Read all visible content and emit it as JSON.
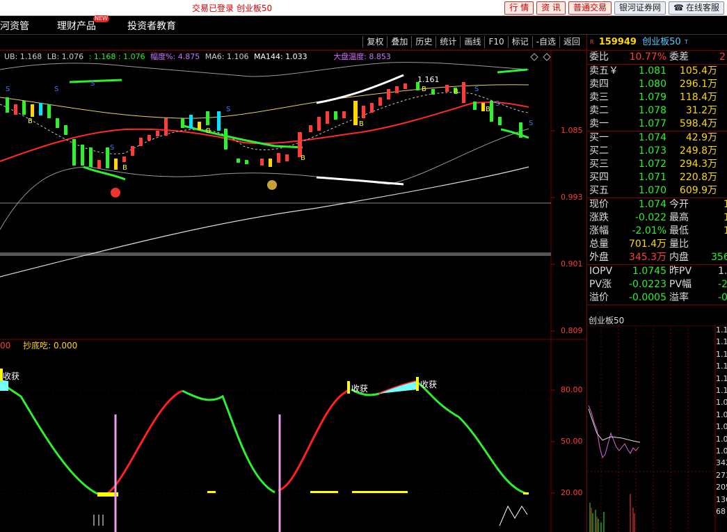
{
  "topbar": {
    "status": "交易已登录  创业板50",
    "buttons": [
      "行 情",
      "资 讯",
      "普通交易"
    ],
    "broker": "银河证券网",
    "service": "在线客服"
  },
  "menu": {
    "items": [
      "河资管",
      "理财产品",
      "投资者教育"
    ],
    "new_badge": "NEW"
  },
  "toolbar": {
    "items": [
      "复权",
      "叠加",
      "历史",
      "统计",
      "画线",
      "F10",
      "标记",
      "-自选",
      "返回"
    ]
  },
  "info": {
    "ub": "UB: 1.168",
    "lb": "LB: 1.076",
    "v1": ": 1.168",
    "v2": ": 1.076",
    "fudu_label": "幅度%:",
    "fudu": "4.875",
    "ma6": "MA6: 1.106",
    "ma144": "MA144: 1.033",
    "dapan_label": "大盘温度:",
    "dapan": "8.853",
    "high_mark": "1.161"
  },
  "main_axis": [
    "1.085",
    "0.993",
    "0.901",
    "0.809"
  ],
  "indicator": {
    "prefix": "00",
    "label": "抄底吃: 0.000",
    "axis": [
      "80.00",
      "50.00",
      "20.00"
    ],
    "tags": [
      "收获",
      "收获",
      "收获"
    ]
  },
  "colors": {
    "up": "#ff3c3c",
    "down": "#2ef02e",
    "cyan": "#00e5ff",
    "yellow": "#ffff00"
  },
  "stock": {
    "r": "R",
    "code": "159949",
    "name": "创业板50",
    "t": "T",
    "weibi_label": "委比",
    "weibi": "10.77%",
    "weicha_label": "委差",
    "weicha": "2",
    "sells": [
      {
        "label": "卖五￥",
        "price": "1.081",
        "vol": "105.4万"
      },
      {
        "label": "卖四",
        "price": "1.080",
        "vol": "296.1万"
      },
      {
        "label": "卖三",
        "price": "1.079",
        "vol": "118.4万"
      },
      {
        "label": "卖二",
        "price": "1.078",
        "vol": "31.2万"
      },
      {
        "label": "卖一",
        "price": "1.077",
        "vol": "598.4万"
      }
    ],
    "buys": [
      {
        "label": "买一",
        "price": "1.074",
        "vol": "42.9万"
      },
      {
        "label": "买二",
        "price": "1.073",
        "vol": "249.8万"
      },
      {
        "label": "买三",
        "price": "1.072",
        "vol": "294.3万"
      },
      {
        "label": "买四",
        "price": "1.071",
        "vol": "220.8万"
      },
      {
        "label": "买五",
        "price": "1.070",
        "vol": "609.9万"
      }
    ],
    "quotes": [
      {
        "l1": "现价",
        "v1": "1.074",
        "c1": "green",
        "l2": "今开",
        "v2": "1"
      },
      {
        "l1": "涨跌",
        "v1": "-0.022",
        "c1": "green",
        "l2": "最高",
        "v2": "1"
      },
      {
        "l1": "涨幅",
        "v1": "-2.01%",
        "c1": "green",
        "l2": "最低",
        "v2": "1"
      },
      {
        "l1": "总量",
        "v1": "701.4万",
        "c1": "yellow",
        "l2": "量比",
        "v2": ""
      },
      {
        "l1": "外盘",
        "v1": "345.3万",
        "c1": "red",
        "l2": "内盘",
        "v2": "356"
      }
    ],
    "iopv": [
      {
        "l1": "IOPV",
        "v1": "1.0745",
        "c1": "green",
        "l2": "昨PV",
        "v2": "1."
      },
      {
        "l1": "PV涨",
        "v1": "-0.0223",
        "c1": "green",
        "l2": "PV幅",
        "v2": "-2"
      },
      {
        "l1": "溢价",
        "v1": "-0.0005",
        "c1": "green",
        "l2": "溢率",
        "v2": "-0"
      }
    ],
    "mini_title": "创业板50",
    "mini_axis": [
      "1.1",
      "1.1",
      "1.1",
      "1.1",
      "1.1",
      "1.1",
      "1.0",
      "1.0",
      "1.0",
      "1.0",
      "1.0",
      "342",
      "273",
      "205",
      "136",
      "68"
    ]
  }
}
